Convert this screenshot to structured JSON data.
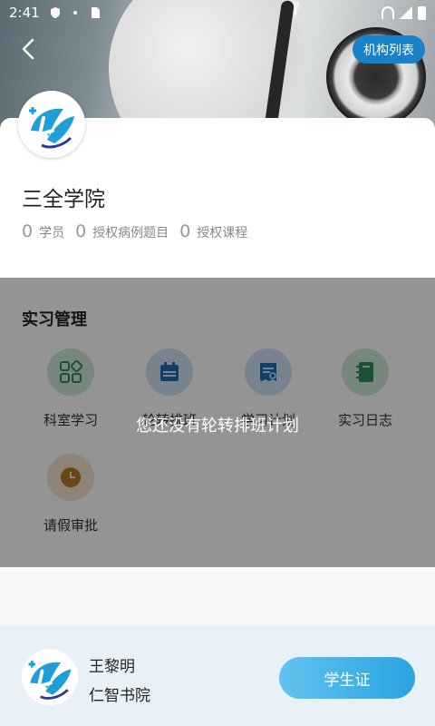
{
  "status_bar": {
    "time": "2:41"
  },
  "header": {
    "org_list_label": "机构列表"
  },
  "school": {
    "name": "三全学院"
  },
  "stats": [
    {
      "value": "0",
      "label": "学员"
    },
    {
      "value": "0",
      "label": "授权病例题目"
    },
    {
      "value": "0",
      "label": "授权课程"
    }
  ],
  "practice": {
    "title": "实习管理",
    "items": [
      {
        "label": "科室学习",
        "icon": "grid-icon",
        "color": "#2f8a5a"
      },
      {
        "label": "轮转排班",
        "icon": "calendar-icon",
        "color": "#1a6fb8"
      },
      {
        "label": "学习计划",
        "icon": "plan-icon",
        "color": "#1a6fb8"
      },
      {
        "label": "实习日志",
        "icon": "notebook-icon",
        "color": "#2f8a5a"
      },
      {
        "label": "请假审批",
        "icon": "clock-icon",
        "color": "#b7772a"
      }
    ]
  },
  "toast": {
    "message": "您还没有轮转排班计划"
  },
  "user": {
    "name": "王黎明",
    "org": "仁智书院",
    "card_label": "学生证"
  }
}
